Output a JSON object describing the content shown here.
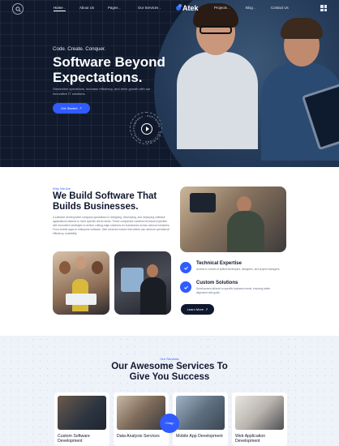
{
  "colors": {
    "accent": "#2f5bff",
    "hero_bg": "#101a2c",
    "dark": "#10182e",
    "services_bg": "#eef2f9"
  },
  "nav": {
    "search_icon": "search-icon",
    "links": [
      {
        "label": "Home",
        "caret": "⌄"
      },
      {
        "label": "About Us"
      },
      {
        "label": "Pages",
        "caret": "⌄"
      },
      {
        "label": "Our Services",
        "caret": "⌄"
      },
      {
        "label": "Projects",
        "caret": "⌄"
      },
      {
        "label": "Blog",
        "caret": "⌄"
      },
      {
        "label": "Contact Us"
      }
    ],
    "logo": "Atek",
    "menu_icon": "grid-menu-icon"
  },
  "hero": {
    "tagline": "Code. Create. Conquer.",
    "title": "Software Beyond Expectations.",
    "subtitle": "Streamline operations, increase efficiency, and drive growth with our innovative IT solutions.",
    "cta_label": "Get Started",
    "cta_icon": "↗",
    "badge_text": "COMPANY · SOFTWARE · SOLUTIONS · DEVELOPMENT ·",
    "play_icon": "play-icon"
  },
  "about": {
    "eyebrow": "Why We Are",
    "title": "We Build Software That Builds Businesses.",
    "text": "A software development company specializes in designing, developing, and deploying software applications tailored to meet specific client needs. These companies combine technical expertise with innovative strategies to deliver cutting-edge solutions for businesses across various industries. From mobile apps to enterprise software, their services ensure that clients can achieve operational efficiency, scalability.",
    "features": [
      {
        "title": "Technical Expertise",
        "desc": "Access to a team of skilled developers, designers, and project managers.",
        "icon": "check-badge-icon"
      },
      {
        "title": "Custom Solutions",
        "desc": "Development tailored to specific business needs, ensuring better alignment with goals.",
        "icon": "check-badge-icon"
      }
    ],
    "learn_more": "Learn More",
    "learn_more_icon": "↗"
  },
  "services": {
    "eyebrow": "Our Services",
    "title": "Our Awesome Services To Give You Success",
    "cards": [
      {
        "title": "Custom Software Development"
      },
      {
        "title": "Data Analysis Services"
      },
      {
        "title": "Mobile App Development"
      },
      {
        "title": "Web Application Development"
      }
    ],
    "drag_label": "Drag",
    "drag_left": "‹",
    "drag_right": "›"
  }
}
